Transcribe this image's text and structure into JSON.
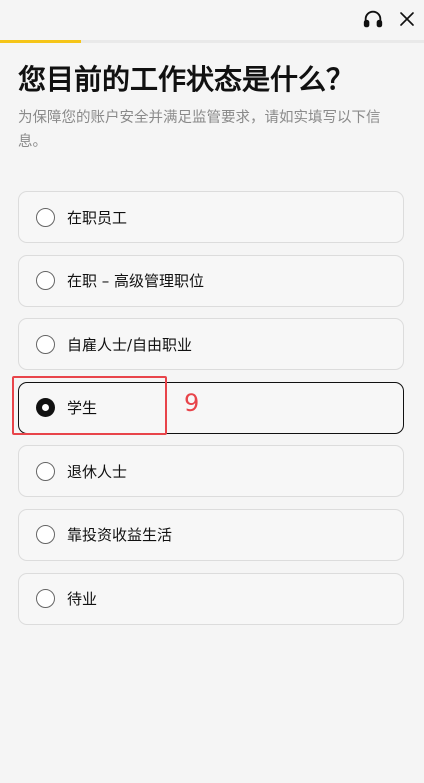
{
  "header": {
    "icons": [
      "headset-icon",
      "close-icon"
    ],
    "progress_fraction": 0.19,
    "progress_color": "#f5c518"
  },
  "title": "您目前的工作状态是什么？",
  "subtitle": "为保障您的账户安全并满足监管要求，请如实填写以下信息。",
  "options": [
    {
      "label": "在职员工",
      "selected": false
    },
    {
      "label": "在职 – 高级管理职位",
      "selected": false
    },
    {
      "label": "自雇人士/自由职业",
      "selected": false
    },
    {
      "label": "学生",
      "selected": true
    },
    {
      "label": "退休人士",
      "selected": false
    },
    {
      "label": "靠投资收益生活",
      "selected": false
    },
    {
      "label": "待业",
      "selected": false
    }
  ],
  "annotation": {
    "number": "9",
    "color": "#e8444a"
  }
}
